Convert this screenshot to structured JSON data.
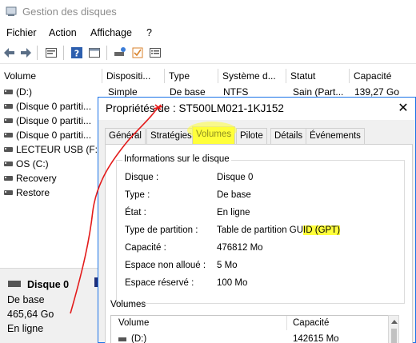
{
  "window": {
    "title": "Gestion des disques"
  },
  "menu": [
    "Fichier",
    "Action",
    "Affichage",
    "?"
  ],
  "toolbar": {
    "icons": [
      "back-arrow-icon",
      "forward-arrow-icon",
      "properties-icon",
      "help-icon",
      "console-icon",
      "disk-icon",
      "check-icon",
      "list-icon"
    ]
  },
  "volume_list": {
    "columns": [
      "Volume",
      "Dispositi...",
      "Type",
      "Système d...",
      "Statut",
      "Capacité"
    ],
    "first_row": {
      "layout": "Simple",
      "type": "De base",
      "fs": "NTFS",
      "status": "Sain (Part...",
      "capacity": "139,27 Go"
    },
    "rows": [
      "(D:)",
      "(Disque 0 partiti...",
      "(Disque 0 partiti...",
      "(Disque 0 partiti...",
      "LECTEUR USB (F:)",
      "OS (C:)",
      "Recovery",
      "Restore"
    ]
  },
  "disk_panel": {
    "name": "Disque 0",
    "type": "De base",
    "size": "465,64 Go",
    "status": "En ligne"
  },
  "dialog": {
    "title": "Propriétés de : ST500LM021-1KJ152",
    "close_label": "✕",
    "tabs": [
      "Général",
      "Stratégies",
      "Volumes",
      "Pilote",
      "Détails",
      "Événements"
    ],
    "active_tab": "Volumes",
    "group_title": "Informations sur le disque",
    "properties": [
      {
        "label": "Disque :",
        "value": "Disque 0"
      },
      {
        "label": "Type :",
        "value": "De base"
      },
      {
        "label": "État :",
        "value": "En ligne"
      },
      {
        "label": "Type de partition :",
        "value_prefix": "Table de partition GU",
        "value_highlight": "ID (GPT)"
      },
      {
        "label": "Capacité :",
        "value": "476812 Mo"
      },
      {
        "label": "Espace non alloué :",
        "value": "5 Mo"
      },
      {
        "label": "Espace réservé :",
        "value": "100 Mo"
      }
    ],
    "volumes_section": {
      "label": "Volumes",
      "columns": [
        "Volume",
        "Capacité"
      ],
      "rows": [
        {
          "volume": "(D:)",
          "capacity": "142615 Mo"
        }
      ]
    }
  },
  "colors": {
    "highlight": "#ffff3b",
    "annotation": "#e31b1b",
    "dialog_border": "#1a73e8"
  }
}
